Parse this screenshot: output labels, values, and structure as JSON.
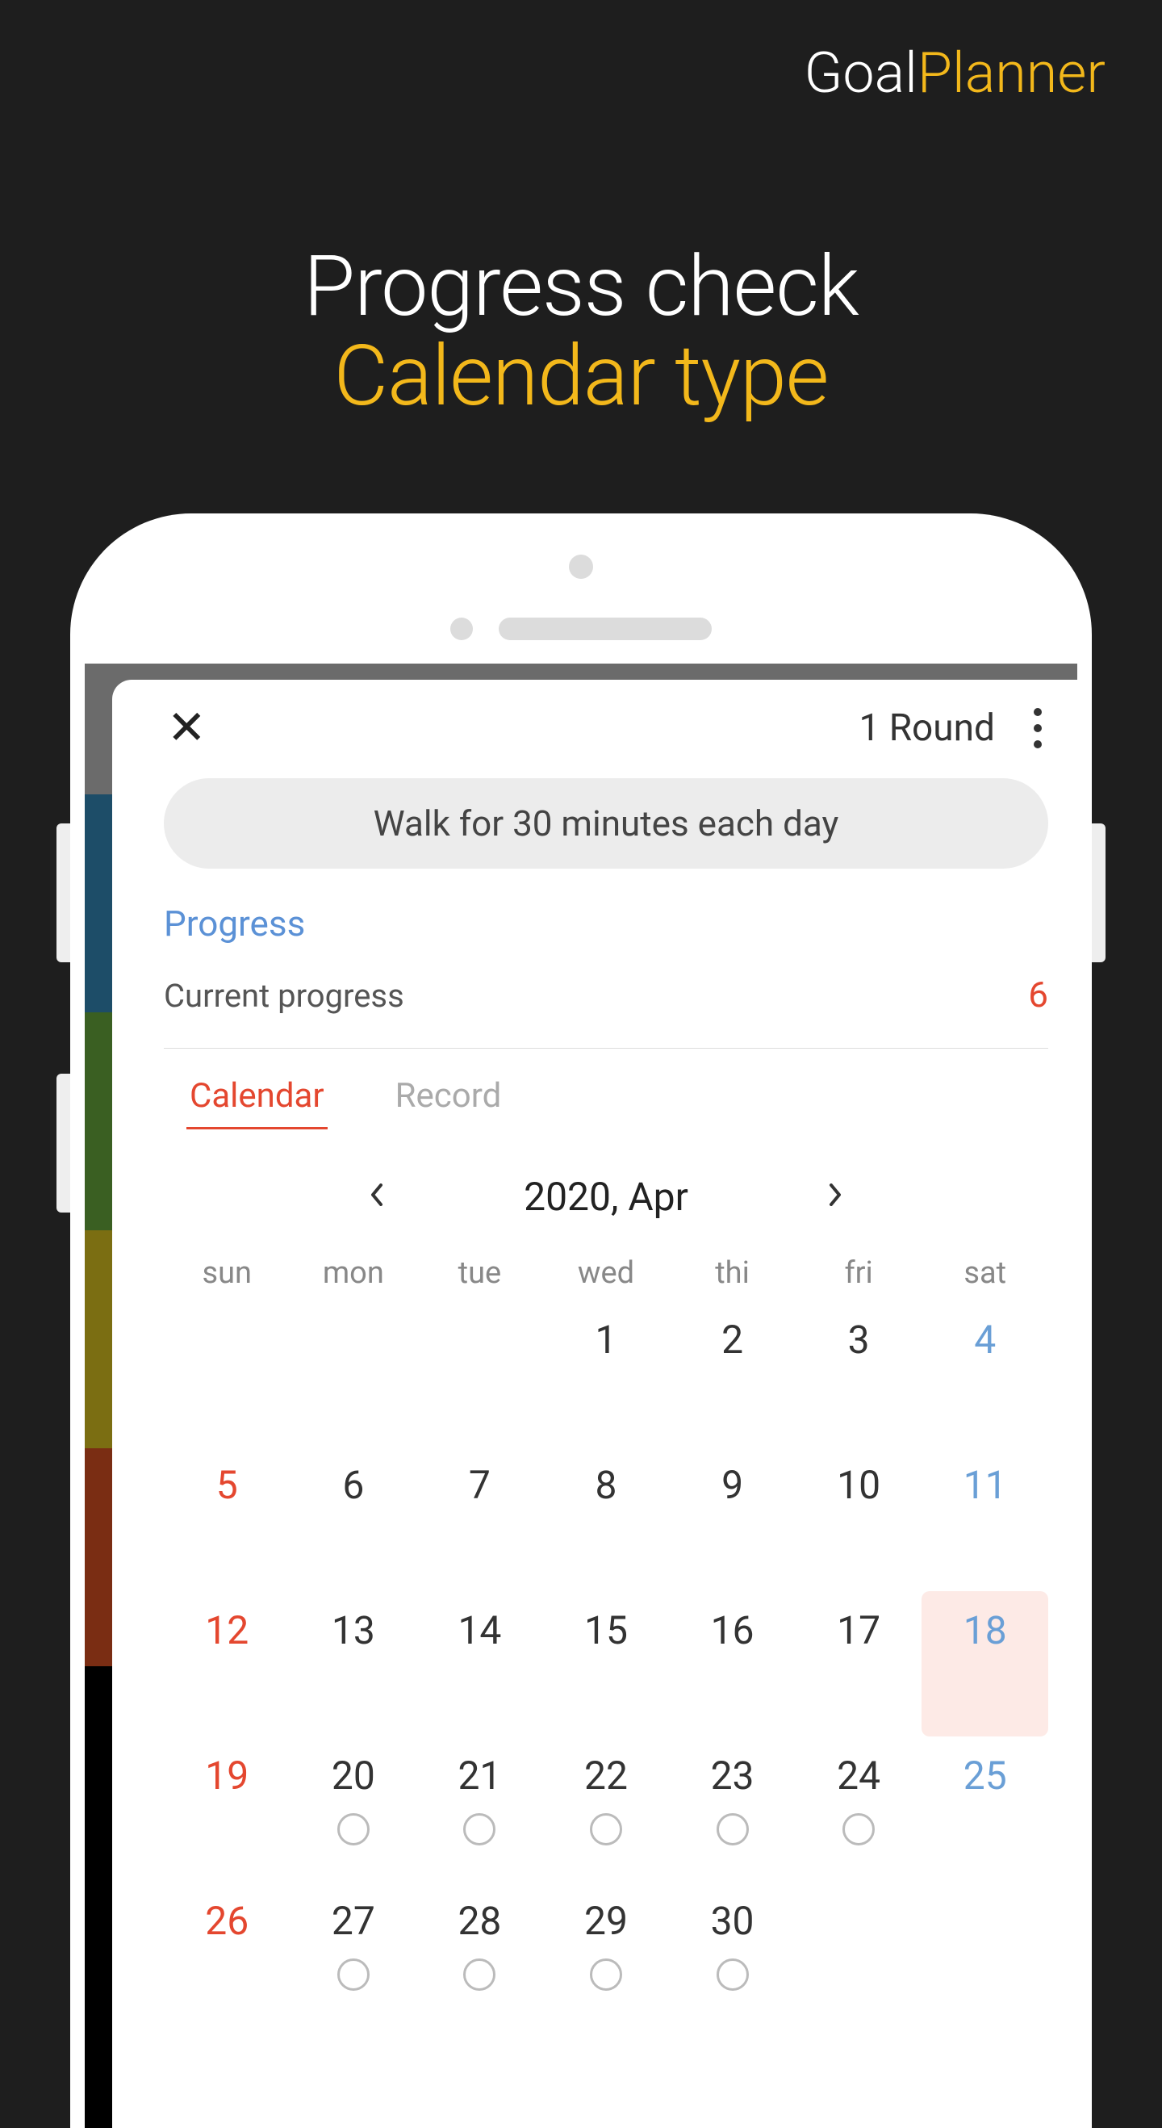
{
  "brand": {
    "part1": "Goal",
    "part2": "Planner"
  },
  "headline": {
    "line1": "Progress check",
    "line2": "Calendar type"
  },
  "sheet": {
    "round_label": "1 Round",
    "goal_text": "Walk for 30 minutes each day",
    "section_title": "Progress",
    "progress_label": "Current progress",
    "progress_value": "6",
    "tabs": {
      "calendar": "Calendar",
      "record": "Record"
    },
    "month_label": "2020, Apr"
  },
  "calendar": {
    "weekdays": [
      "sun",
      "mon",
      "tue",
      "wed",
      "thi",
      "fri",
      "sat"
    ],
    "rows": [
      [
        {
          "n": "",
          "cls": "empty"
        },
        {
          "n": "",
          "cls": "empty"
        },
        {
          "n": "",
          "cls": "empty"
        },
        {
          "n": "1"
        },
        {
          "n": "2"
        },
        {
          "n": "3"
        },
        {
          "n": "4",
          "cls": "sat"
        }
      ],
      [
        {
          "n": "5",
          "cls": "sun"
        },
        {
          "n": "6"
        },
        {
          "n": "7"
        },
        {
          "n": "8"
        },
        {
          "n": "9"
        },
        {
          "n": "10"
        },
        {
          "n": "11",
          "cls": "sat"
        }
      ],
      [
        {
          "n": "12",
          "cls": "sun"
        },
        {
          "n": "13"
        },
        {
          "n": "14"
        },
        {
          "n": "15"
        },
        {
          "n": "16"
        },
        {
          "n": "17"
        },
        {
          "n": "18",
          "cls": "sat today"
        }
      ],
      [
        {
          "n": "19",
          "cls": "sun"
        },
        {
          "n": "20",
          "ring": true
        },
        {
          "n": "21",
          "ring": true
        },
        {
          "n": "22",
          "ring": true
        },
        {
          "n": "23",
          "ring": true
        },
        {
          "n": "24",
          "ring": true
        },
        {
          "n": "25",
          "cls": "sat"
        }
      ],
      [
        {
          "n": "26",
          "cls": "sun"
        },
        {
          "n": "27",
          "ring": true
        },
        {
          "n": "28",
          "ring": true
        },
        {
          "n": "29",
          "ring": true
        },
        {
          "n": "30",
          "ring": true
        },
        {
          "n": "",
          "cls": "empty"
        },
        {
          "n": "",
          "cls": "empty"
        }
      ]
    ]
  }
}
